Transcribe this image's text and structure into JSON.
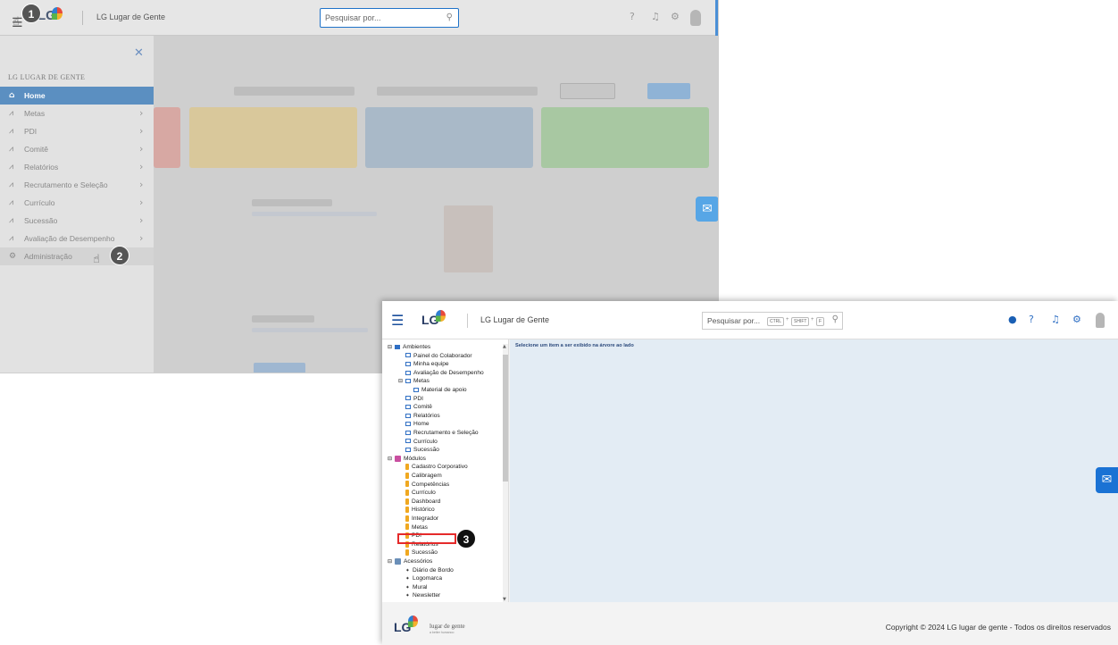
{
  "back": {
    "company": "LG Lugar de Gente",
    "logo": "LG",
    "search_placeholder": "Pesquisar por...",
    "sidebar": {
      "section": "LG LUGAR DE GENTE",
      "items": [
        {
          "label": "Home",
          "icon": "home-icon"
        },
        {
          "label": "Metas",
          "icon": "chart-icon"
        },
        {
          "label": "PDI",
          "icon": "chart-icon"
        },
        {
          "label": "Comitê",
          "icon": "chart-icon"
        },
        {
          "label": "Relatórios",
          "icon": "chart-icon"
        },
        {
          "label": "Recrutamento e Seleção",
          "icon": "chart-icon"
        },
        {
          "label": "Currículo",
          "icon": "chart-icon"
        },
        {
          "label": "Sucessão",
          "icon": "chart-icon"
        },
        {
          "label": "Avaliação de Desempenho",
          "icon": "chart-icon"
        },
        {
          "label": "Administração",
          "icon": "gear-icon"
        }
      ]
    },
    "steps": [
      "1",
      "2"
    ]
  },
  "front": {
    "company": "LG Lugar de Gente",
    "logo": "LG",
    "search_placeholder": "Pesquisar por...",
    "shortcut": [
      "CTRL",
      "SHIFT",
      "F"
    ],
    "content_message": "Selecione um item a ser exibido na árvore ao lado",
    "tree": {
      "ambientes": {
        "label": "Ambientes",
        "items": [
          "Painel do Colaborador",
          "Minha equipe",
          "Avaliação de Desempenho",
          "Metas",
          "Material de apoio",
          "PDI",
          "Comitê",
          "Relatórios",
          "Home",
          "Recrutamento e Seleção",
          "Currículo",
          "Sucessão"
        ]
      },
      "modulos": {
        "label": "Módulos",
        "items": [
          "Cadastro Corporativo",
          "Calibragem",
          "Competências",
          "Currículo",
          "Dashboard",
          "Histórico",
          "Integrador",
          "Metas",
          "PDI",
          "Relatórios",
          "Sucessão"
        ]
      },
      "acessorios": {
        "label": "Acessórios",
        "items": [
          "Diário de Bordo",
          "Logomarca",
          "Mural",
          "Newsletter"
        ]
      }
    },
    "step": "3",
    "footer": {
      "logo": "LG",
      "tagline": "lugar de gente",
      "tagline2": "a better humanoo",
      "copyright": "Copyright © 2024 LG lugar de gente - Todos os direitos reservados"
    }
  }
}
